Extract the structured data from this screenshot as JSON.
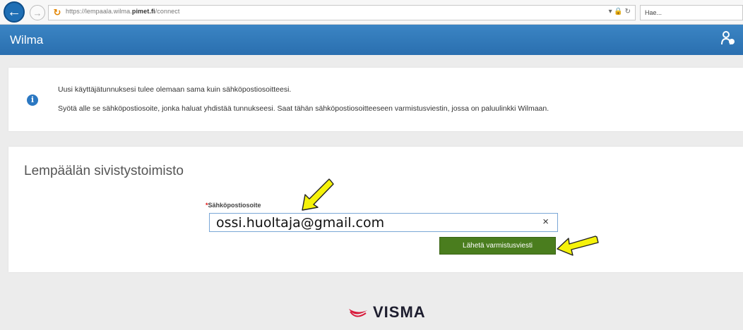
{
  "browser": {
    "url_prefix": "https://lempaala.wilma.",
    "url_domain": "pimet.fi",
    "url_path": "/connect",
    "addr_tools": "▾ 🔒 ↻",
    "search_placeholder": "Hae..."
  },
  "header": {
    "title": "Wilma"
  },
  "info": {
    "line1": "Uusi käyttäjätunnuksesi tulee olemaan sama kuin sähköpostiosoitteesi.",
    "line2": "Syötä alle se sähköpostiosoite, jonka haluat yhdistää tunnukseesi. Saat tähän sähköpostiosoitteeseen varmistusviestin, jossa on paluulinkki Wilmaan."
  },
  "form": {
    "org_title": "Lempäälän sivistystoimisto",
    "required_mark": "*",
    "email_label": "Sähköpostiosoite",
    "email_value": "ossi.huoltaja@gmail.com",
    "clear_glyph": "×",
    "send_button": "Lähetä varmistusviesti"
  },
  "footer": {
    "logo_text": "VISMA"
  },
  "colors": {
    "header_blue": "#2a6faf",
    "button_green": "#4a7d1e",
    "arrow_yellow": "#f2f200"
  }
}
